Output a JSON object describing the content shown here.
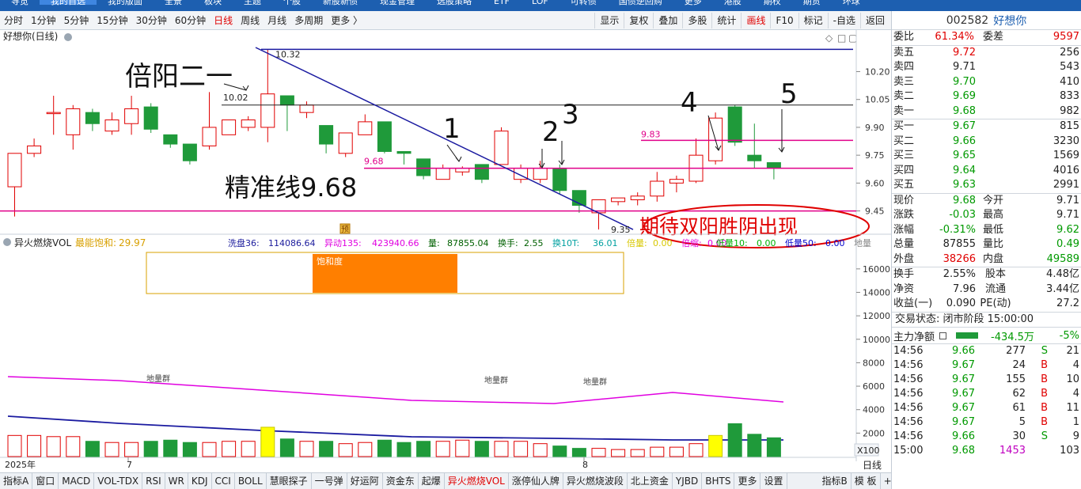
{
  "topnav": [
    "导览",
    "我的自选",
    "我的版面",
    "全景",
    "板块",
    "主题",
    "个股",
    "新股新债",
    "现金管理",
    "选股策略",
    "ETF",
    "LOF",
    "可转债",
    "国债逆回购",
    "更多",
    "港股",
    "期权",
    "期货",
    "环球"
  ],
  "periods": [
    "分时",
    "1分钟",
    "5分钟",
    "15分钟",
    "30分钟",
    "60分钟",
    "日线",
    "周线",
    "月线",
    "多周期",
    "更多 〉"
  ],
  "active_period": "日线",
  "tools": [
    "显示",
    "复权",
    "叠加",
    "多股",
    "统计",
    "画线",
    "F10",
    "标记",
    "-自选",
    "返回"
  ],
  "active_tool": "画线",
  "kline": {
    "title": "好想你(日线)",
    "y_ticks": [
      "10.20",
      "10.05",
      "9.90",
      "9.75",
      "9.60",
      "9.45"
    ],
    "annotations": {
      "a1": "倍阳二一",
      "a2": "精准线9.68",
      "a3": "期待双阳胜阴出现",
      "n1": "1",
      "n2": "2",
      "n3": "3",
      "n4": "4",
      "n5": "5",
      "high_label": "10.32",
      "l1002": "10.02",
      "l983": "9.83",
      "l968": "9.68",
      "low_label": "9.35",
      "flag": "预"
    }
  },
  "vol": {
    "name": "异火燃烧VOL",
    "sat_label": "最能饱和:",
    "sat_val": "29.97",
    "stats": [
      {
        "k": "洗盘36:",
        "v": "114086.64",
        "color": "#1a1a9c"
      },
      {
        "k": "异动135:",
        "v": "423940.66",
        "color": "#e000e0"
      },
      {
        "k": "量:",
        "v": "87855.04",
        "color": "#006000"
      },
      {
        "k": "换手:",
        "v": "2.55",
        "color": "#006000"
      },
      {
        "k": "换10T:",
        "v": "36.01",
        "color": "#00a0a0"
      },
      {
        "k": "倍量:",
        "v": "0.00",
        "color": "#d8c800"
      },
      {
        "k": "倍缩:",
        "v": "0.00",
        "color": "#e000e0"
      },
      {
        "k": "低量10:",
        "v": "0.00",
        "color": "#00b000"
      },
      {
        "k": "低量50:",
        "v": "0.00",
        "color": "#0000cc"
      },
      {
        "k": "地量",
        "v": "",
        "color": "#888888"
      }
    ],
    "box_label": "饱和度",
    "ground_labels": [
      "地量群",
      "地量群",
      "地量群"
    ],
    "y_ticks": [
      "16000",
      "14000",
      "12000",
      "10000",
      "8000",
      "6000",
      "4000",
      "2000"
    ],
    "unit": "X100"
  },
  "xaxis": {
    "labels": [
      "2025年",
      "7",
      "8"
    ],
    "period": "日线"
  },
  "tabs": [
    "指标A",
    "窗口",
    "MACD",
    "VOL-TDX",
    "RSI",
    "WR",
    "KDJ",
    "CCI",
    "BOLL",
    "慧眼探子",
    "一号弹",
    "好运阿",
    "资金东",
    "起爆",
    "异火燃烧VOL",
    "涨停仙人牌",
    "异火燃烧波段",
    "北上资金",
    "YJBD",
    "BHTS",
    "更多",
    "设置",
    "指标B",
    "模 板",
    "+",
    "-"
  ],
  "active_tab": "异火燃烧VOL",
  "quote": {
    "code": "002582",
    "name": "好想你",
    "weibi": {
      "k": "委比",
      "v": "61.34%",
      "k2": "委差",
      "v2": "9597"
    },
    "asks": [
      {
        "k": "卖五",
        "p": "9.72",
        "v": "256",
        "c": "red"
      },
      {
        "k": "卖四",
        "p": "9.71",
        "v": "543",
        "c": "dark"
      },
      {
        "k": "卖三",
        "p": "9.70",
        "v": "410",
        "c": "green"
      },
      {
        "k": "卖二",
        "p": "9.69",
        "v": "833",
        "c": "green"
      },
      {
        "k": "卖一",
        "p": "9.68",
        "v": "982",
        "c": "green"
      }
    ],
    "bids": [
      {
        "k": "买一",
        "p": "9.67",
        "v": "815",
        "c": "green"
      },
      {
        "k": "买二",
        "p": "9.66",
        "v": "3230",
        "c": "green"
      },
      {
        "k": "买三",
        "p": "9.65",
        "v": "1569",
        "c": "green"
      },
      {
        "k": "买四",
        "p": "9.64",
        "v": "4016",
        "c": "green"
      },
      {
        "k": "买五",
        "p": "9.63",
        "v": "2991",
        "c": "green"
      }
    ],
    "info": [
      {
        "k": "现价",
        "v": "9.68",
        "vc": "green",
        "k2": "今开",
        "v2": "9.71",
        "v2c": "dark"
      },
      {
        "k": "涨跌",
        "v": "-0.03",
        "vc": "green",
        "k2": "最高",
        "v2": "9.71",
        "v2c": "dark"
      },
      {
        "k": "涨幅",
        "v": "-0.31%",
        "vc": "green",
        "k2": "最低",
        "v2": "9.62",
        "v2c": "green"
      },
      {
        "k": "总量",
        "v": "87855",
        "vc": "dark",
        "k2": "量比",
        "v2": "0.49",
        "v2c": "green"
      },
      {
        "k": "外盘",
        "v": "38266",
        "vc": "red",
        "k2": "内盘",
        "v2": "49589",
        "v2c": "green"
      }
    ],
    "info2": [
      {
        "k": "换手",
        "v": "2.55%",
        "k2": "股本",
        "v2": "4.48亿"
      },
      {
        "k": "净资",
        "v": "7.96",
        "k2": "流通",
        "v2": "3.44亿"
      },
      {
        "k": "收益(一)",
        "v": "0.090",
        "k2": "PE(动)",
        "v2": "27.2"
      }
    ],
    "status": "交易状态: 闭市阶段 15:00:00",
    "zl_label": "主力净额",
    "zl_value": "-434.5万",
    "zl_pct": "-5%",
    "ticks": [
      {
        "t": "14:56",
        "p": "9.66",
        "v": "277",
        "f": "S",
        "n": "21"
      },
      {
        "t": "14:56",
        "p": "9.67",
        "v": "24",
        "f": "B",
        "n": "4"
      },
      {
        "t": "14:56",
        "p": "9.67",
        "v": "155",
        "f": "B",
        "n": "10"
      },
      {
        "t": "14:56",
        "p": "9.67",
        "v": "62",
        "f": "B",
        "n": "4"
      },
      {
        "t": "14:56",
        "p": "9.67",
        "v": "61",
        "f": "B",
        "n": "11"
      },
      {
        "t": "14:56",
        "p": "9.67",
        "v": "5",
        "f": "B",
        "n": "1"
      },
      {
        "t": "14:56",
        "p": "9.66",
        "v": "30",
        "f": "S",
        "n": "9"
      },
      {
        "t": "15:00",
        "p": "9.68",
        "v": "1453",
        "f": "",
        "n": "103"
      }
    ]
  },
  "chart_data": {
    "type": "candlestick",
    "candles": [
      {
        "o": 9.58,
        "c": 9.76,
        "h": 9.76,
        "l": 9.42
      },
      {
        "o": 9.76,
        "c": 9.8,
        "h": 9.84,
        "l": 9.74
      },
      {
        "o": 9.98,
        "c": 9.98,
        "h": 10.07,
        "l": 9.86
      },
      {
        "o": 9.86,
        "c": 10.0,
        "h": 10.02,
        "l": 9.78
      },
      {
        "o": 9.98,
        "c": 9.92,
        "h": 10.0,
        "l": 9.88
      },
      {
        "o": 9.88,
        "c": 9.94,
        "h": 9.98,
        "l": 9.86
      },
      {
        "o": 9.92,
        "c": 10.0,
        "h": 10.07,
        "l": 9.86
      },
      {
        "o": 10.01,
        "c": 9.89,
        "h": 10.03,
        "l": 9.87
      },
      {
        "o": 9.86,
        "c": 9.81,
        "h": 9.86,
        "l": 9.79
      },
      {
        "o": 9.81,
        "c": 9.72,
        "h": 9.81,
        "l": 9.7
      },
      {
        "o": 9.8,
        "c": 9.9,
        "h": 10.09,
        "l": 9.78
      },
      {
        "o": 9.86,
        "c": 9.94,
        "h": 9.94,
        "l": 9.86
      },
      {
        "o": 9.9,
        "c": 9.94,
        "h": 9.96,
        "l": 9.88
      },
      {
        "o": 9.9,
        "c": 10.08,
        "h": 10.32,
        "l": 9.82
      },
      {
        "o": 10.07,
        "c": 10.02,
        "h": 10.07,
        "l": 9.88
      },
      {
        "o": 9.98,
        "c": 10.02,
        "h": 10.04,
        "l": 9.95
      },
      {
        "o": 9.91,
        "c": 9.81,
        "h": 9.91,
        "l": 9.76
      },
      {
        "o": 9.76,
        "c": 9.87,
        "h": 9.87,
        "l": 9.74
      },
      {
        "o": 9.86,
        "c": 9.93,
        "h": 9.97,
        "l": 9.86
      },
      {
        "o": 9.93,
        "c": 9.77,
        "h": 9.93,
        "l": 9.76
      },
      {
        "o": 9.77,
        "c": 9.76,
        "h": 9.77,
        "l": 9.7
      },
      {
        "o": 9.73,
        "c": 9.64,
        "h": 9.73,
        "l": 9.62
      },
      {
        "o": 9.62,
        "c": 9.68,
        "h": 9.7,
        "l": 9.62
      },
      {
        "o": 9.66,
        "c": 9.68,
        "h": 9.69,
        "l": 9.64
      },
      {
        "o": 9.7,
        "c": 9.62,
        "h": 9.7,
        "l": 9.6
      },
      {
        "o": 9.7,
        "c": 9.88,
        "h": 9.9,
        "l": 9.7
      },
      {
        "o": 9.62,
        "c": 9.68,
        "h": 9.7,
        "l": 9.6
      },
      {
        "o": 9.62,
        "c": 9.68,
        "h": 9.72,
        "l": 9.6
      },
      {
        "o": 9.68,
        "c": 9.56,
        "h": 9.7,
        "l": 9.54
      },
      {
        "o": 9.56,
        "c": 9.48,
        "h": 9.56,
        "l": 9.44
      },
      {
        "o": 9.44,
        "c": 9.51,
        "h": 9.51,
        "l": 9.35
      },
      {
        "o": 9.5,
        "c": 9.52,
        "h": 9.52,
        "l": 9.48
      },
      {
        "o": 9.51,
        "c": 9.53,
        "h": 9.55,
        "l": 9.48
      },
      {
        "o": 9.53,
        "c": 9.61,
        "h": 9.66,
        "l": 9.5
      },
      {
        "o": 9.6,
        "c": 9.62,
        "h": 9.64,
        "l": 9.55
      },
      {
        "o": 9.61,
        "c": 9.75,
        "h": 9.84,
        "l": 9.6
      },
      {
        "o": 9.72,
        "c": 9.95,
        "h": 9.98,
        "l": 9.7
      },
      {
        "o": 10.01,
        "c": 9.82,
        "h": 10.02,
        "l": 9.8
      },
      {
        "o": 9.75,
        "c": 9.72,
        "h": 9.92,
        "l": 9.68
      },
      {
        "o": 9.71,
        "c": 9.68,
        "h": 9.71,
        "l": 9.62
      }
    ],
    "volume": [
      1800,
      1800,
      1700,
      1700,
      1300,
      1200,
      1200,
      1300,
      1400,
      1200,
      1200,
      1300,
      1300,
      2500,
      1500,
      1300,
      1300,
      1100,
      1200,
      1400,
      1200,
      1300,
      1300,
      1400,
      1300,
      1300,
      1300,
      1100,
      900,
      700,
      700,
      600,
      600,
      800,
      800,
      1100,
      1800,
      2800,
      1900,
      1600,
      1000
    ],
    "ylim": [
      9.38,
      10.33
    ]
  }
}
